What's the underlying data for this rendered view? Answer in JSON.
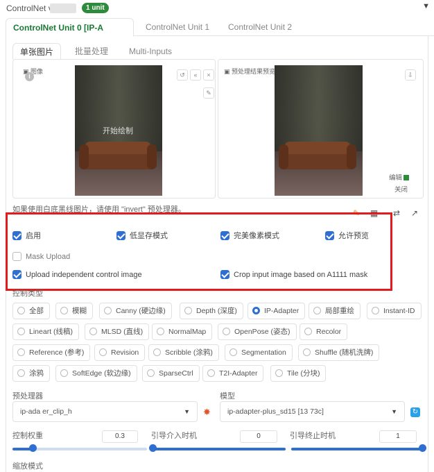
{
  "header": {
    "title": "ControlNet v1",
    "badge": "1 unit",
    "collapse_icon": "caret-down-icon"
  },
  "unit_tabs": [
    {
      "label": "ControlNet Unit 0 [IP-A"
    },
    {
      "label": "ControlNet Unit 1"
    },
    {
      "label": "ControlNet Unit 2"
    }
  ],
  "image_tabs": [
    {
      "label": "单张图片"
    },
    {
      "label": "批量处理"
    },
    {
      "label": "Multi-Inputs"
    }
  ],
  "input_image": {
    "label": "图像",
    "overlay": "开始绘制"
  },
  "preview_image": {
    "label": "预处理结果预览",
    "edit": "编辑",
    "close": "关闭"
  },
  "hint": "如果使用白底黑线图片，请使用 \"invert\" 预处理器。",
  "checkboxes": [
    {
      "label": "启用",
      "checked": true
    },
    {
      "label": "低显存模式",
      "checked": true
    },
    {
      "label": "完美像素模式",
      "checked": true
    },
    {
      "label": "允许预览",
      "checked": true
    },
    {
      "label": "Mask Upload",
      "checked": false
    },
    {
      "label": "Upload independent control image",
      "checked": true
    },
    {
      "label": "Crop input image based on A1111 mask",
      "checked": true
    }
  ],
  "control_type_label": "控制类型",
  "control_types": [
    {
      "label": "全部"
    },
    {
      "label": "模糊"
    },
    {
      "label": "Canny (硬边缘)"
    },
    {
      "label": "Depth (深度)"
    },
    {
      "label": "IP-Adapter"
    },
    {
      "label": "局部重绘"
    },
    {
      "label": "Instant-ID"
    },
    {
      "label": "Lineart (线稿)"
    },
    {
      "label": "MLSD (直线)"
    },
    {
      "label": "NormalMap"
    },
    {
      "label": "OpenPose (姿态)"
    },
    {
      "label": "Recolor"
    },
    {
      "label": "Reference (参考)"
    },
    {
      "label": "Revision"
    },
    {
      "label": "Scribble (涂鸦)"
    },
    {
      "label": "Segmentation"
    },
    {
      "label": "Shuffle (随机洗牌)"
    },
    {
      "label": "涂鸦"
    },
    {
      "label": "SoftEdge (软边缘)"
    },
    {
      "label": "SparseCtrl"
    },
    {
      "label": "T2I-Adapter"
    },
    {
      "label": "Tile (分块)"
    }
  ],
  "selected_control_type": "IP-Adapter",
  "preprocessor": {
    "label": "预处理器",
    "value": "ip-ada   er_clip_h"
  },
  "model": {
    "label": "模型",
    "value": "ip-adapter-plus_sd15 [13    73c]"
  },
  "control_weight": {
    "label": "控制权重",
    "value": "0.3"
  },
  "start_step": {
    "label": "引导介入时机",
    "value": "0"
  },
  "end_step": {
    "label": "引导终止时机",
    "value": "1"
  },
  "resize_mode_label": "缩放模式",
  "colors": {
    "accent": "#2f6fd1",
    "badge": "#2e8b3d",
    "highlight": "#e21c1c",
    "tab_active": "#1a7a35"
  }
}
